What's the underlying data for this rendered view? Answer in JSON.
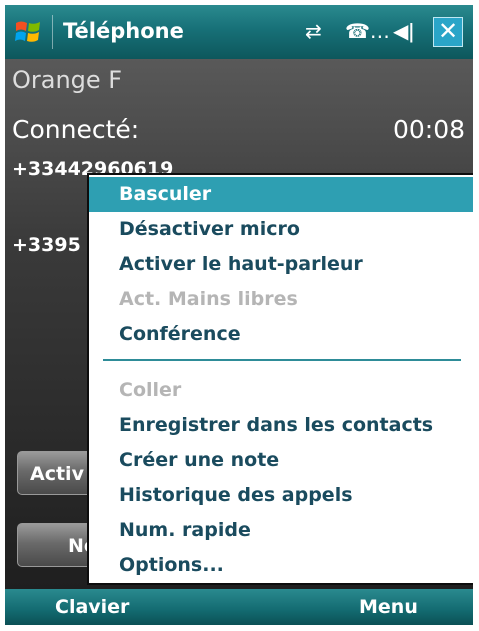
{
  "titlebar": {
    "title": "Téléphone",
    "icons": [
      "start-icon",
      "sync-icon",
      "call-icon",
      "volume-icon",
      "close-icon"
    ],
    "close_label": "✕"
  },
  "call": {
    "operator": "Orange F",
    "status": "Connecté:",
    "timer": "00:08",
    "number_1": "+33442960619",
    "number_2": "+3395",
    "activate_button": "Activ",
    "no_button": "No"
  },
  "menu": {
    "items": [
      {
        "label": "Basculer",
        "state": "selected"
      },
      {
        "label": "Désactiver micro",
        "state": "enabled"
      },
      {
        "label": "Activer le haut-parleur",
        "state": "enabled"
      },
      {
        "label": "Act. Mains libres",
        "state": "disabled"
      },
      {
        "label": "Conférence",
        "state": "enabled"
      },
      {
        "label": "Coller",
        "state": "disabled"
      },
      {
        "label": "Enregistrer dans les contacts",
        "state": "enabled"
      },
      {
        "label": "Créer une note",
        "state": "enabled"
      },
      {
        "label": "Historique des appels",
        "state": "enabled"
      },
      {
        "label": "Num. rapide",
        "state": "enabled"
      },
      {
        "label": "Options...",
        "state": "enabled"
      }
    ]
  },
  "softkeys": {
    "left": "Clavier",
    "right": "Menu"
  },
  "colors": {
    "titlebar": "#177077",
    "menu_highlight": "#2e9fb2",
    "menu_text": "#1a4b5e",
    "menu_disabled": "#b5b5b5"
  }
}
